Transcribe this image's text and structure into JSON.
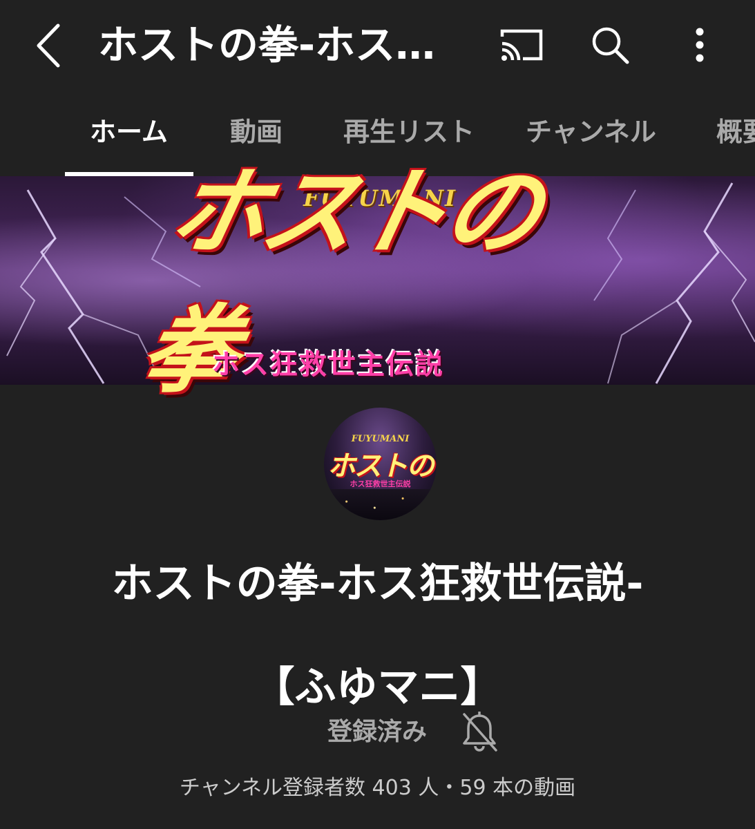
{
  "appbar": {
    "title": "ホストの拳-ホス…",
    "back_icon": "chevron-left-icon",
    "cast_icon": "cast-icon",
    "search_icon": "search-icon",
    "more_icon": "more-vert-icon"
  },
  "tabs": [
    {
      "label": "ホーム",
      "active": true
    },
    {
      "label": "動画",
      "active": false
    },
    {
      "label": "再生リスト",
      "active": false
    },
    {
      "label": "チャンネル",
      "active": false
    },
    {
      "label": "概要",
      "active": false
    }
  ],
  "banner": {
    "fuyumani": "FUYUMANI",
    "logo": "ホストの拳",
    "subtitle": "ホス狂救世主伝説"
  },
  "avatar": {
    "fuyumani": "FUYUMANI",
    "logo": "ホストの拳",
    "subtitle": "ホス狂救世主伝説"
  },
  "channel": {
    "name_line1": "ホストの拳-ホス狂救世伝説-",
    "name_line2": "【ふゆマニ】",
    "subscribed_label": "登録済み",
    "bell_icon": "bell-off-icon",
    "stats": "チャンネル登録者数 403 人・59 本の動画"
  },
  "colors": {
    "background": "#212121",
    "text_primary": "#ffffff",
    "text_secondary": "#aaaaaa"
  }
}
